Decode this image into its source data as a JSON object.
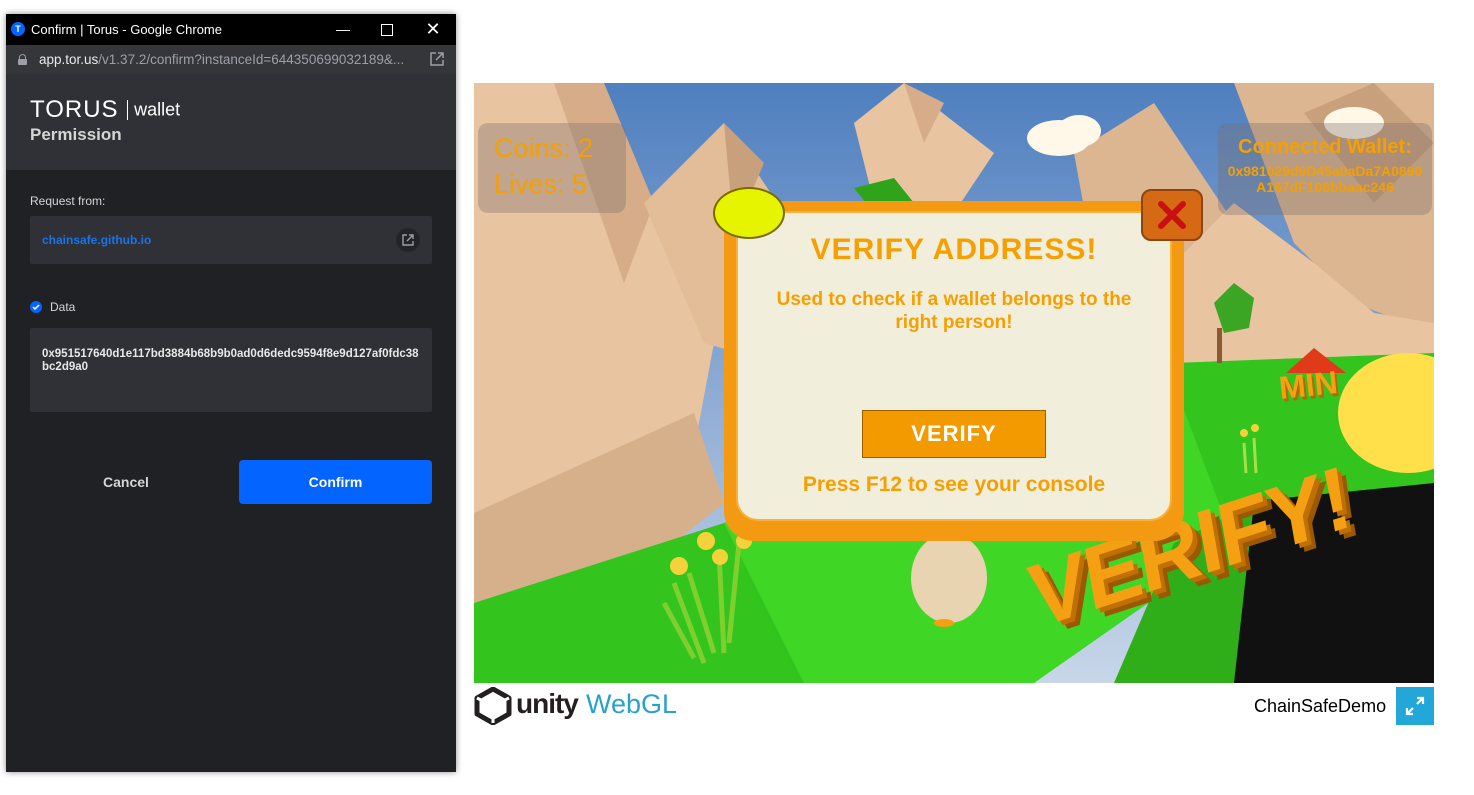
{
  "window": {
    "title": "Confirm | Torus - Google Chrome",
    "url_host": "app.tor.us",
    "url_rest": "/v1.37.2/confirm?instanceId=644350699032189&..."
  },
  "torus": {
    "brand": "TORUS",
    "wallet_label": "wallet",
    "page_title": "Permission",
    "request_label": "Request from:",
    "request_origin": "chainsafe.github.io",
    "data_label": "Data",
    "data_value": "0x951517640d1e117bd3884b68b9b0ad0d6dedc9594f8e9d127af0fdc38bc2d9a0",
    "cancel_label": "Cancel",
    "confirm_label": "Confirm",
    "accent_color": "#0364ff"
  },
  "game": {
    "coins": "Coins: 2",
    "lives": "Lives: 5",
    "wallet_title": "Connected Wallet:",
    "wallet_address": "0x981029d9D45a0aDa7A0890A167dF108bbaac246",
    "dialog_title": "VERIFY ADDRESS!",
    "dialog_subtitle": "Used to check if a wallet belongs to the right person!",
    "verify_button": "VERIFY",
    "hint": "Press F12 to see your console",
    "scene_text_verify": "VERIFY!",
    "scene_text_min": "MIN",
    "ui_color": "#f5a000"
  },
  "footer": {
    "unity": "unity",
    "webgl": "WebGL",
    "demo_title": "ChainSafeDemo"
  }
}
